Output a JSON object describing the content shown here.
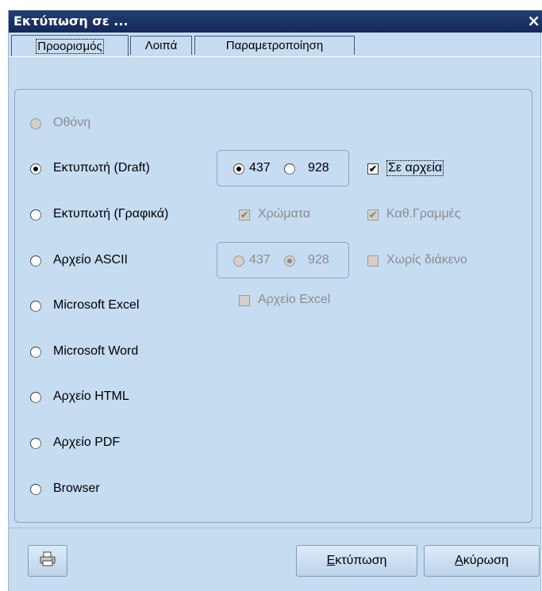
{
  "window": {
    "title": "Εκτύπωση σε ...",
    "close_glyph": "×"
  },
  "tabs": [
    {
      "label": "Προορισμός",
      "active": true
    },
    {
      "label": "Λοιπά",
      "active": false
    },
    {
      "label": "Παραμετροποίηση",
      "active": false
    }
  ],
  "destinations": [
    {
      "label": "Οθόνη",
      "enabled": false,
      "selected": false
    },
    {
      "label": "Εκτυπωτή (Draft)",
      "enabled": true,
      "selected": true
    },
    {
      "label": "Εκτυπωτή (Γραφικά)",
      "enabled": true,
      "selected": false
    },
    {
      "label": "Αρχείο ASCII",
      "enabled": true,
      "selected": false
    },
    {
      "label": "Microsoft Excel",
      "enabled": true,
      "selected": false
    },
    {
      "label": "Microsoft Word",
      "enabled": true,
      "selected": false
    },
    {
      "label": "Αρχείο HTML",
      "enabled": true,
      "selected": false
    },
    {
      "label": "Αρχείο PDF",
      "enabled": true,
      "selected": false
    },
    {
      "label": "Browser",
      "enabled": true,
      "selected": false
    }
  ],
  "draft_codepage": {
    "option_437": "437",
    "option_928": "928",
    "selected": "437"
  },
  "ascii_codepage": {
    "option_437": "437",
    "option_928": "928",
    "selected": "928",
    "enabled": false
  },
  "options": {
    "to_files": {
      "label": "Σε αρχεία",
      "checked": true,
      "enabled": true
    },
    "colors": {
      "label": "Χρώματα",
      "checked": true,
      "enabled": false
    },
    "lines": {
      "label": "Καθ.Γραμμές",
      "checked": true,
      "enabled": false
    },
    "no_spacing": {
      "label": "Χωρίς διάκενο",
      "checked": false,
      "enabled": false
    },
    "excel_file": {
      "label": "Αρχείο Excel",
      "checked": false,
      "enabled": false
    }
  },
  "buttons": {
    "printer_icon": "printer-icon",
    "print_hotkey": "Ε",
    "print_rest": "κτύπωση",
    "cancel_hotkey": "Α",
    "cancel_rest": "κύρωση"
  }
}
